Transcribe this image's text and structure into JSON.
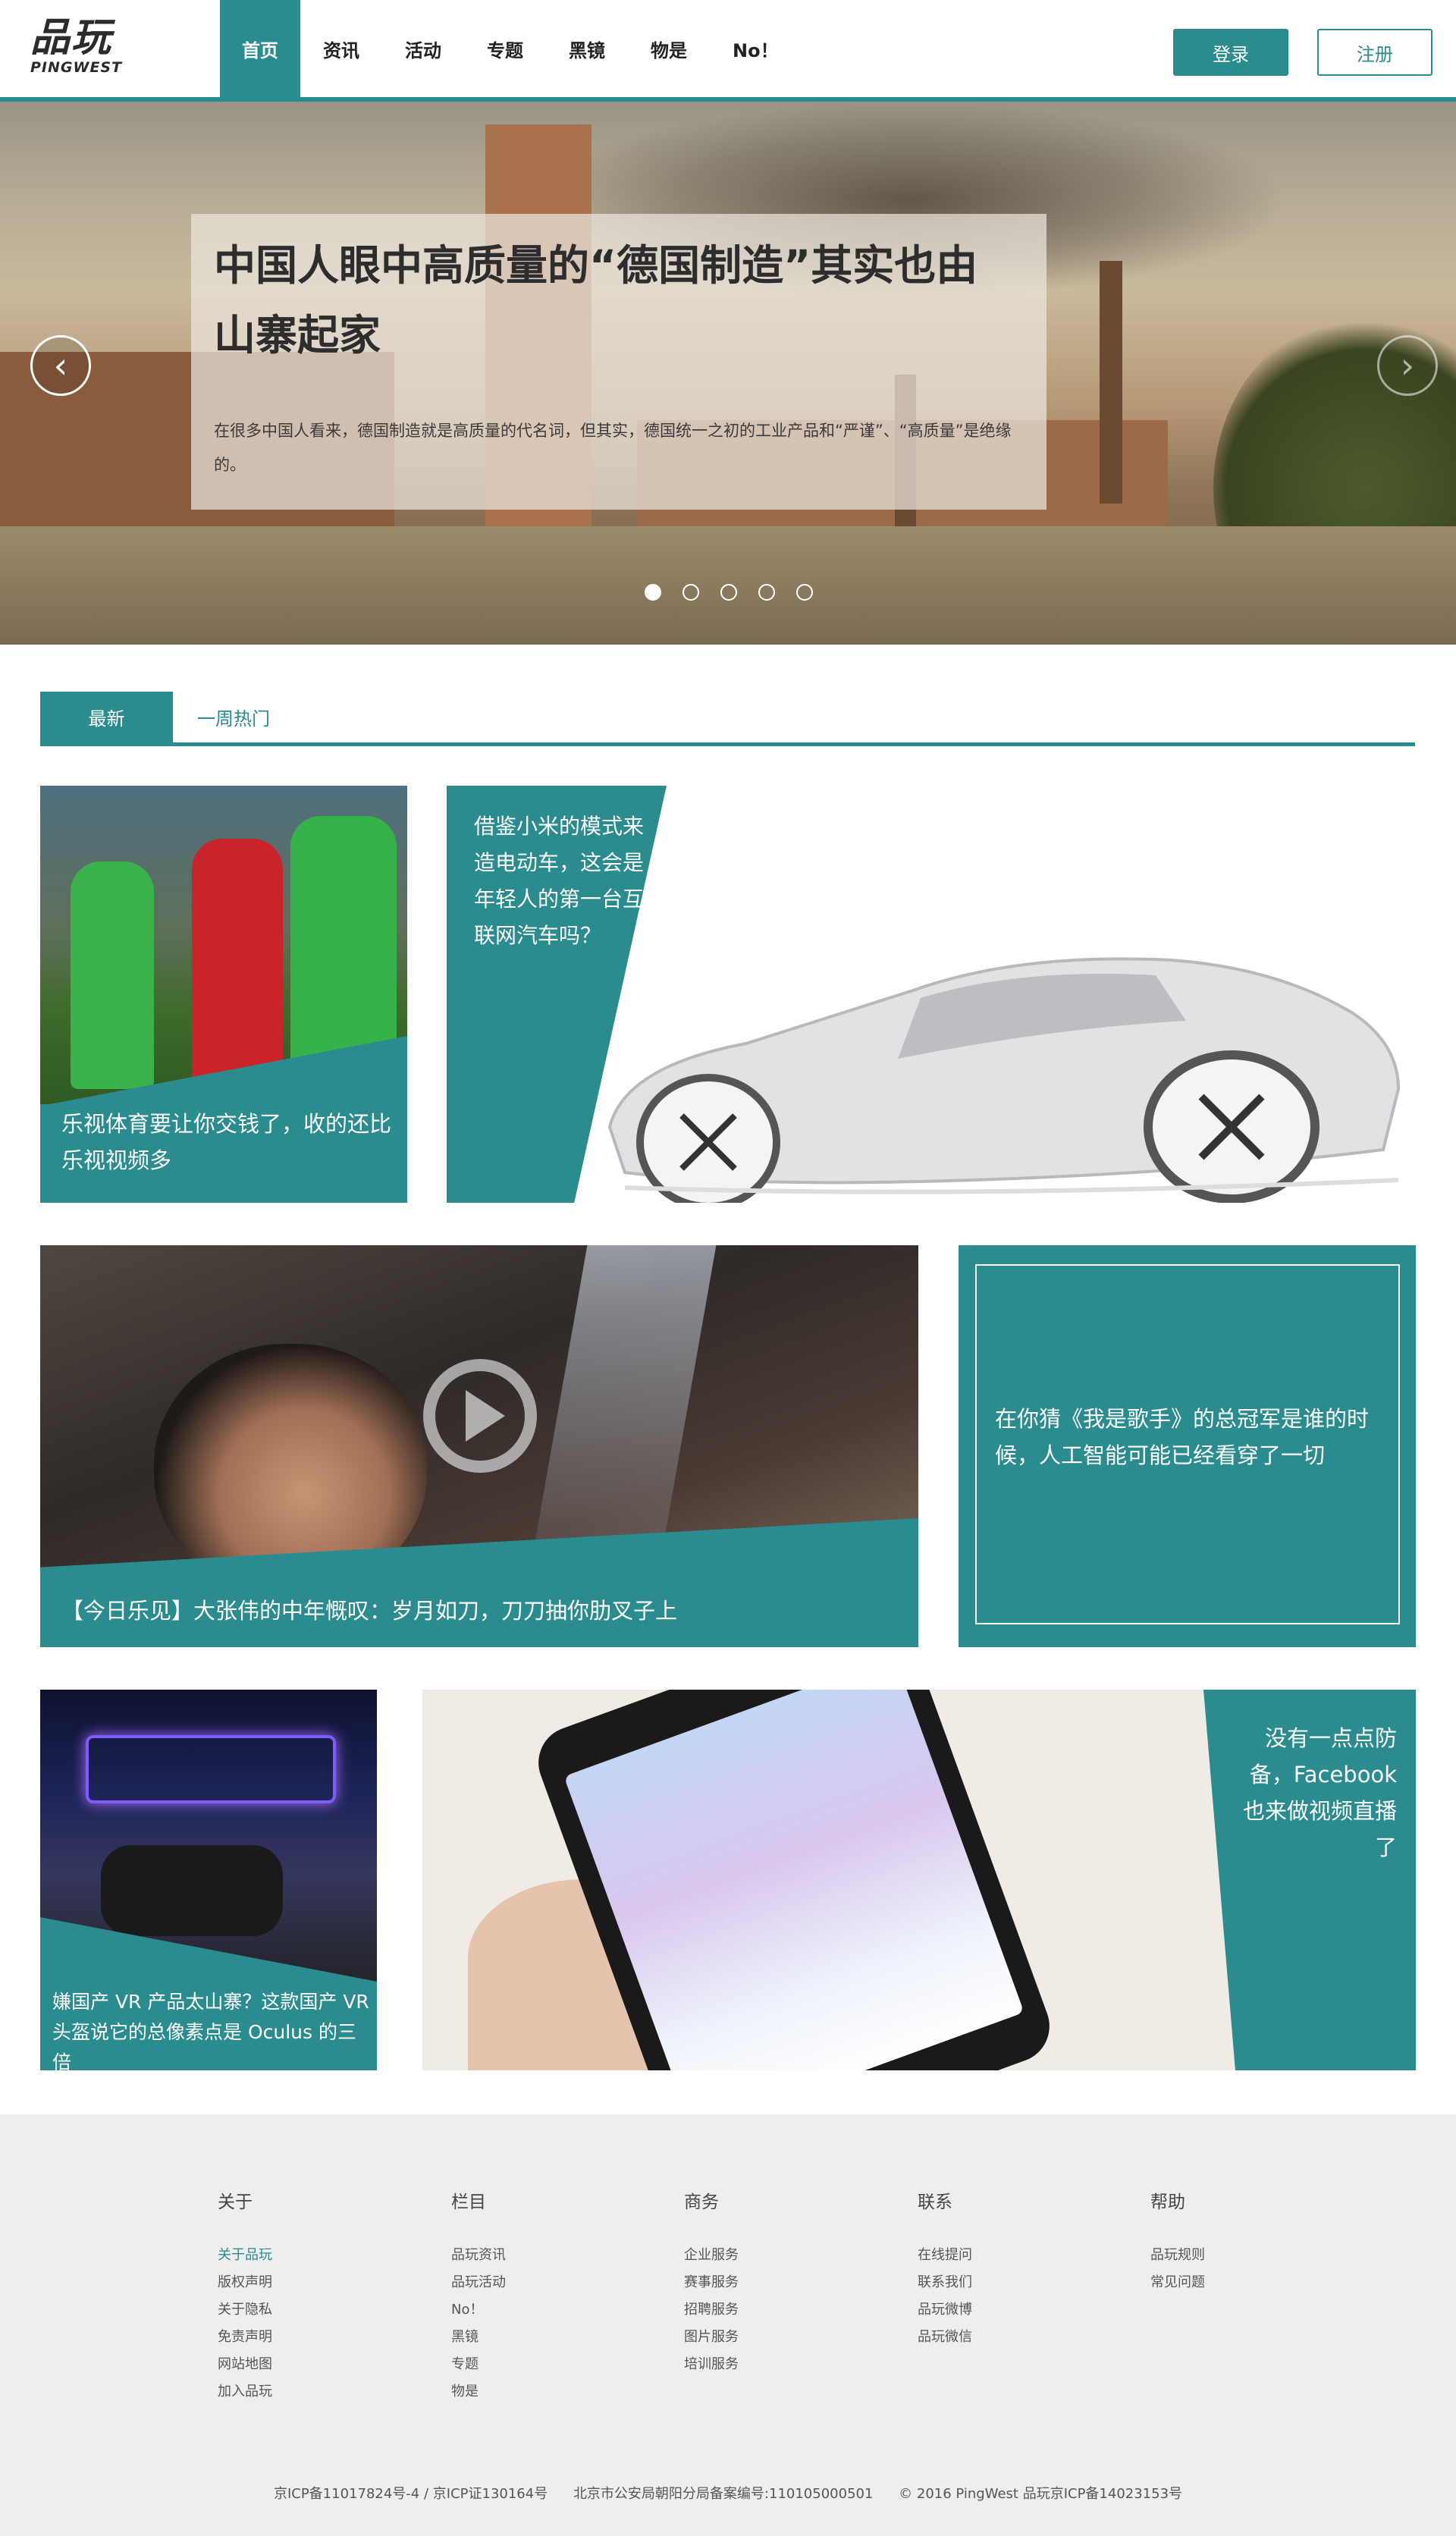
{
  "brand": {
    "cn": "品玩",
    "en": "PINGWEST"
  },
  "nav": {
    "items": [
      "首页",
      "资讯",
      "活动",
      "专题",
      "黑镜",
      "物是",
      "No！"
    ],
    "active": 0
  },
  "auth": {
    "login": "登录",
    "register": "注册"
  },
  "hero": {
    "title": "中国人眼中高质量的“德国制造”其实也由山寨起家",
    "desc": "在很多中国人看来，德国制造就是高质量的代名词，但其实，德国统一之初的工业产品和“严谨”、“高质量”是绝缘的。",
    "prev_icon": "chevron-left-icon",
    "next_icon": "chevron-right-icon",
    "slide_count": 5,
    "active_slide": 0
  },
  "tabs": [
    "最新",
    "一周热门"
  ],
  "cards": [
    {
      "text": "乐视体育要让你交钱了，收的还比乐视视频多"
    },
    {
      "text": "借鉴小米的模式来造电动车，这会是年轻人的第一台互联网汽车吗？"
    },
    {
      "text": "【今日乐见】大张伟的中年慨叹：岁月如刀，刀刀抽你肋叉子上"
    },
    {
      "text": "在你猜《我是歌手》的总冠军是谁的时候，人工智能可能已经看穿了一切"
    },
    {
      "text": "嫌国产 VR 产品太山寨？这款国产 VR 头盔说它的总像素点是 Oculus 的三倍"
    },
    {
      "text": "没有一点点防备，Facebook 也来做视频直播了"
    }
  ],
  "footer": {
    "columns": [
      {
        "title": "关于",
        "links": [
          "关于品玩",
          "版权声明",
          "关于隐私",
          "免责声明",
          "网站地图",
          "加入品玩"
        ]
      },
      {
        "title": "栏目",
        "links": [
          "品玩资讯",
          "品玩活动",
          "No！",
          "黑镜",
          "专题",
          "物是"
        ]
      },
      {
        "title": "商务",
        "links": [
          "企业服务",
          "赛事服务",
          "招聘服务",
          "图片服务",
          "培训服务"
        ]
      },
      {
        "title": "联系",
        "links": [
          "在线提问",
          "联系我们",
          "品玩微博",
          "品玩微信"
        ]
      },
      {
        "title": "帮助",
        "links": [
          "品玩规则",
          "常见问题"
        ]
      }
    ],
    "copyright": [
      "京ICP备11017824号-4 / 京ICP证130164号",
      "北京市公安局朝阳分局备案编号:110105000501",
      "© 2016 PingWest 品玩京ICP备14023153号"
    ]
  },
  "colors": {
    "accent": "#2b8c8f",
    "footer_bg": "#eeeeee"
  }
}
